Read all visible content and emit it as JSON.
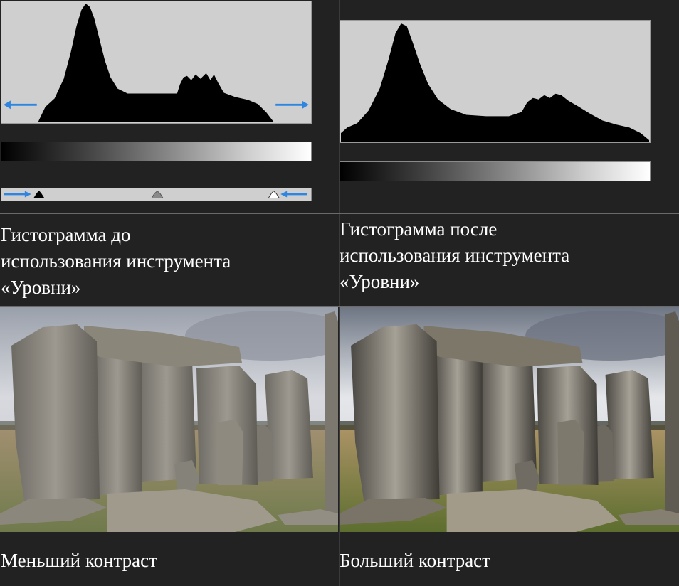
{
  "top_left": {
    "caption_lines": [
      "Гистограмма до",
      "использования инструмента",
      "«Уровни»"
    ]
  },
  "top_right": {
    "caption_lines": [
      "Гистограмма после",
      "использования инструмента",
      "«Уровни»"
    ]
  },
  "bottom_left": {
    "caption": "Меньший контраст",
    "contrast": "low"
  },
  "bottom_right": {
    "caption": "Больший контраст",
    "contrast": "high"
  },
  "colors": {
    "background": "#222222",
    "histogram_bg": "#cfcfcf",
    "histogram_fill": "#000000",
    "arrow": "#2f86e0",
    "text": "#ffffff"
  },
  "icons": [
    "left-arrow-icon",
    "right-arrow-icon",
    "black-point-slider-icon",
    "midtone-slider-icon",
    "white-point-slider-icon"
  ]
}
